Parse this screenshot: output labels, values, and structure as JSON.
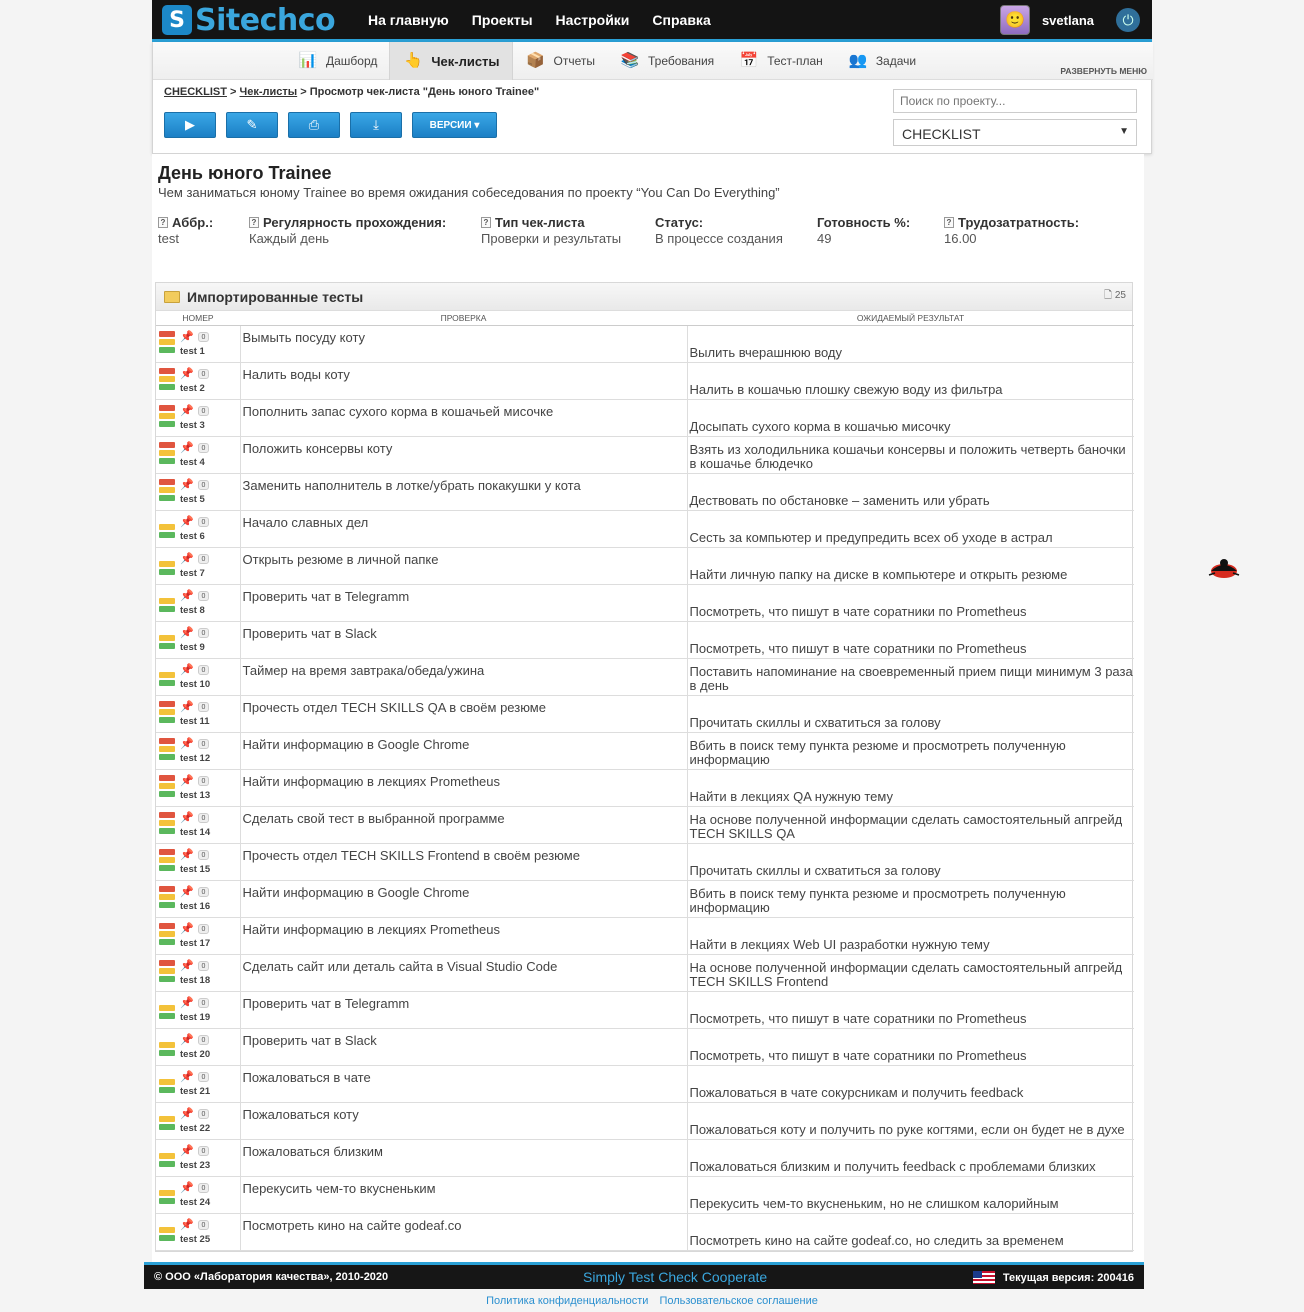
{
  "logo": {
    "mark": "S",
    "text": "Sitechco"
  },
  "main_nav": [
    "На главную",
    "Проекты",
    "Настройки",
    "Справка"
  ],
  "user": {
    "name": "svetlana"
  },
  "sub_nav": [
    {
      "label": "Дашборд",
      "icon": "dashboard-icon",
      "glyph": "📊"
    },
    {
      "label": "Чек-листы",
      "icon": "checklist-icon",
      "glyph": "👆",
      "active": true
    },
    {
      "label": "Отчеты",
      "icon": "reports-icon",
      "glyph": "📦"
    },
    {
      "label": "Требования",
      "icon": "requirements-icon",
      "glyph": "📚"
    },
    {
      "label": "Тест-план",
      "icon": "testplan-icon",
      "glyph": "📅"
    },
    {
      "label": "Задачи",
      "icon": "tasks-icon",
      "glyph": "👥"
    }
  ],
  "expand_menu": "РАЗВЕРНУТЬ МЕНЮ",
  "breadcrumb": {
    "root": "CHECKLIST",
    "section": "Чек-листы",
    "current": "Просмотр чек-листа \"День юного Trainee\""
  },
  "actions": {
    "versions_label": "ВЕРСИИ ▾"
  },
  "search": {
    "placeholder": "Поиск по проекту..."
  },
  "project_select": {
    "value": "CHECKLIST"
  },
  "checklist": {
    "title": "День юного Trainee",
    "description": "Чем заниматься юному Trainee во время ожидания собеседования по проекту “You Can Do Everything”",
    "meta": [
      {
        "label": "Аббр.:",
        "value": "test",
        "help": true
      },
      {
        "label": "Регулярность прохождения:",
        "value": "Каждый день",
        "help": true
      },
      {
        "label": "Тип чек-листа",
        "value": "Проверки и результаты",
        "help": true
      },
      {
        "label": "Статус:",
        "value": "В процессе создания",
        "help": false
      },
      {
        "label": "Готовность %:",
        "value": "49",
        "help": false
      },
      {
        "label": "Трудозатратность:",
        "value": "16.00",
        "help": true
      }
    ]
  },
  "section": {
    "title": "Импортированные тесты",
    "count": "25",
    "columns": [
      "НОМЕР",
      "ПРОВЕРКА",
      "ОЖИДАЕМЫЙ РЕЗУЛЬТАТ"
    ],
    "rows": [
      {
        "id": "test 1",
        "count": "0",
        "check": "Вымыть посуду коту",
        "expected": "Вылить вчерашнюю воду",
        "flags": [
          "red",
          "yellow",
          "green"
        ]
      },
      {
        "id": "test 2",
        "count": "0",
        "check": "Налить воды коту",
        "expected": "Налить в кошачью плошку свежую воду из фильтра",
        "flags": [
          "red",
          "yellow",
          "green"
        ]
      },
      {
        "id": "test 3",
        "count": "0",
        "check": "Пополнить запас сухого корма в кошачьей мисочке",
        "expected": "Досыпать сухого корма в кошачью мисочку",
        "flags": [
          "red",
          "yellow",
          "green"
        ]
      },
      {
        "id": "test 4",
        "count": "0",
        "check": "Положить консервы коту",
        "expected": "Взять из холодильника кошачьи консервы и положить четверть баночки в кошачье блюдечко",
        "flags": [
          "red",
          "yellow",
          "green"
        ]
      },
      {
        "id": "test 5",
        "count": "0",
        "check": "Заменить наполнитель в лотке/убрать покакушки у кота",
        "expected": "Дествовать по обстановке – заменить или убрать",
        "flags": [
          "red",
          "yellow",
          "green"
        ]
      },
      {
        "id": "test 6",
        "count": "0",
        "check": "Начало славных дел",
        "expected": "Сесть за компьютер и предупредить всех об уходе в астрал",
        "flags": [
          "yellow",
          "green"
        ]
      },
      {
        "id": "test 7",
        "count": "0",
        "check": "Открыть резюме в личной папке",
        "expected": "Найти личную папку на диске в компьютере и открыть резюме",
        "flags": [
          "yellow",
          "green"
        ]
      },
      {
        "id": "test 8",
        "count": "0",
        "check": "Проверить чат в Telegramm",
        "expected": "Посмотреть, что пишут в чате соратники по Prometheus",
        "flags": [
          "yellow",
          "green"
        ]
      },
      {
        "id": "test 9",
        "count": "0",
        "check": "Проверить чат в Slack",
        "expected": "Посмотреть, что пишут в чате соратники по Prometheus",
        "flags": [
          "yellow",
          "green"
        ]
      },
      {
        "id": "test 10",
        "count": "0",
        "check": "Таймер на время завтрака/обеда/ужина",
        "expected": "Поставить напоминание на своевременный прием пищи минимум 3 раза в день",
        "flags": [
          "yellow",
          "green"
        ]
      },
      {
        "id": "test 11",
        "count": "0",
        "check": "Прочесть отдел TECH SKILLS QA в своём резюме",
        "expected": "Прочитать скиллы и схватиться за голову",
        "flags": [
          "red",
          "yellow",
          "green"
        ]
      },
      {
        "id": "test 12",
        "count": "0",
        "check": "Найти информацию в Google Chrome",
        "expected": "Вбить в поиск тему пункта резюме и просмотреть полученную информацию",
        "flags": [
          "red",
          "yellow",
          "green"
        ]
      },
      {
        "id": "test 13",
        "count": "0",
        "check": "Найти информацию в лекциях Prometheus",
        "expected": "Найти в лекциях QA нужную тему",
        "flags": [
          "red",
          "yellow",
          "green"
        ]
      },
      {
        "id": "test 14",
        "count": "0",
        "check": "Сделать свой тест в выбранной программе",
        "expected": "На основе полученной информации сделать самостоятельный апгрейд TECH SKILLS QA",
        "flags": [
          "red",
          "yellow",
          "green"
        ]
      },
      {
        "id": "test 15",
        "count": "0",
        "check": "Прочесть отдел TECH SKILLS Frontend в своём резюме",
        "expected": "Прочитать скиллы и схватиться за голову",
        "flags": [
          "red",
          "yellow",
          "green"
        ]
      },
      {
        "id": "test 16",
        "count": "0",
        "check": "Найти информацию в Google Chrome",
        "expected": "Вбить в поиск тему пункта резюме и просмотреть полученную информацию",
        "flags": [
          "red",
          "yellow",
          "green"
        ]
      },
      {
        "id": "test 17",
        "count": "0",
        "check": "Найти информацию в лекциях Prometheus",
        "expected": "Найти в лекциях Web UI разработки нужную тему",
        "flags": [
          "red",
          "yellow",
          "green"
        ]
      },
      {
        "id": "test 18",
        "count": "0",
        "check": "Сделать сайт или деталь сайта в Visual Studio Code",
        "expected": "На основе полученной информации сделать самостоятельный апгрейд TECH SKILLS Frontend",
        "flags": [
          "red",
          "yellow",
          "green"
        ]
      },
      {
        "id": "test 19",
        "count": "0",
        "check": "Проверить чат в Telegramm",
        "expected": "Посмотреть, что пишут в чате соратники по Prometheus",
        "flags": [
          "yellow",
          "green"
        ]
      },
      {
        "id": "test 20",
        "count": "0",
        "check": "Проверить чат в Slack",
        "expected": "Посмотреть, что пишут в чате соратники по Prometheus",
        "flags": [
          "yellow",
          "green"
        ]
      },
      {
        "id": "test 21",
        "count": "0",
        "check": "Пожаловаться в чате",
        "expected": "Пожаловаться в чате сокурсникам и получить feedback",
        "flags": [
          "yellow",
          "green"
        ]
      },
      {
        "id": "test 22",
        "count": "0",
        "check": "Пожаловаться коту",
        "expected": "Пожаловаться коту и получить по руке когтями, если он будет не в духе",
        "flags": [
          "yellow",
          "green"
        ]
      },
      {
        "id": "test 23",
        "count": "0",
        "check": "Пожаловаться близким",
        "expected": "Пожаловаться близким и получить feedback с проблемами близких",
        "flags": [
          "yellow",
          "green"
        ]
      },
      {
        "id": "test 24",
        "count": "0",
        "check": "Перекусить чем-то вкусненьким",
        "expected": "Перекусить чем-то вкусненьким, но не слишком калорийным",
        "flags": [
          "yellow",
          "green"
        ]
      },
      {
        "id": "test 25",
        "count": "0",
        "check": "Посмотреть кино на сайте godeaf.co",
        "expected": "Посмотреть кино на сайте godeaf.co, но следить за временем",
        "flags": [
          "yellow",
          "green"
        ]
      }
    ]
  },
  "flag_colors": {
    "red": "#e0553f",
    "yellow": "#f3c23a",
    "green": "#5bb85d"
  },
  "accent_color": "#2aa0d6",
  "footer": {
    "copyright": "© ООО «Лаборатория качества», 2010-2020",
    "slogan": "Simply Test Check Cooperate",
    "version": "Текущая версия: 200416"
  },
  "legal": {
    "privacy": "Политика конфиденциальности",
    "terms": "Пользовательское соглашение"
  }
}
